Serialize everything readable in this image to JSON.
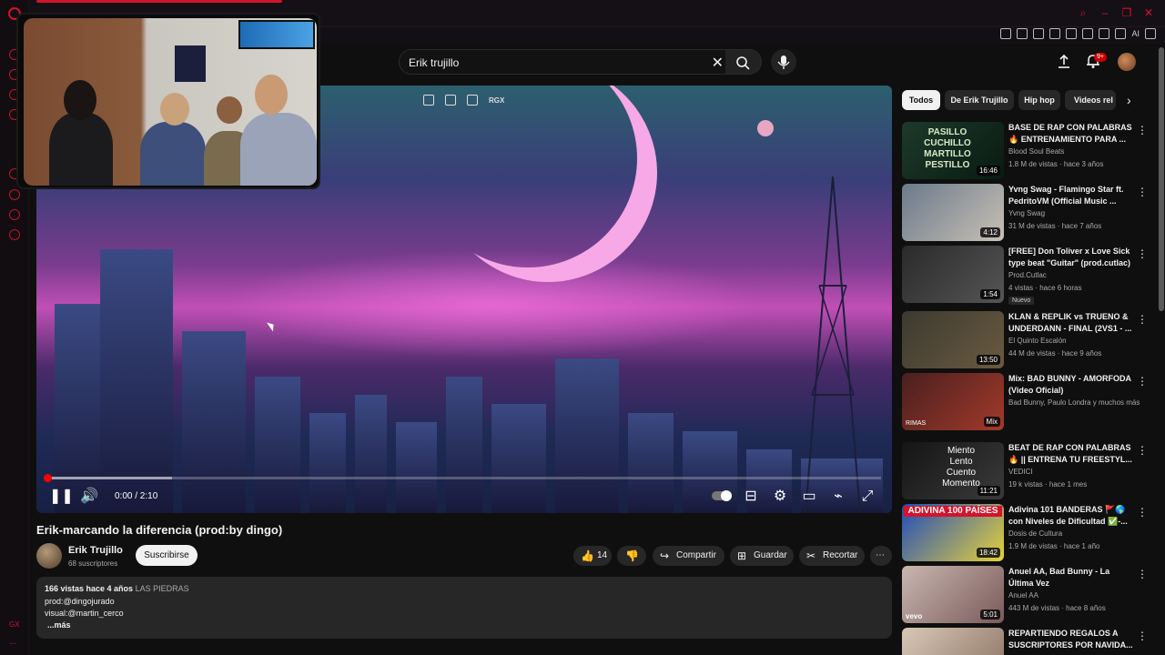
{
  "browser": {
    "accent": "#d3142c",
    "sidebar_label": "GX",
    "sidebar_more": "...",
    "toolbar_ai": "AI"
  },
  "header": {
    "search_value": "Erik trujillo",
    "notif_badge": "9+"
  },
  "player": {
    "overlay_text": "RGX",
    "time": "0:00 / 2:10",
    "progress_fraction": 0.0,
    "buffer_fraction": 0.15
  },
  "video": {
    "title": "Erik-marcando la diferencia (prod:by dingo)",
    "channel": "Erik Trujillo",
    "subscribers": "68 suscriptores",
    "subscribe_label": "Suscribirse",
    "likes": "14",
    "share_label": "Compartir",
    "save_label": "Guardar",
    "clip_label": "Recortar"
  },
  "description": {
    "stats": "166 vistas  hace 4 años",
    "location": "LAS PIEDRAS",
    "line1": "prod:@dingojurado",
    "line2": "visual:@martin_cerco",
    "more": "...más"
  },
  "chips": [
    "Todos",
    "De Erik Trujillo",
    "Hip hop",
    "Videos rel"
  ],
  "recommendations": [
    {
      "title": "BASE DE RAP CON PALABRAS 🔥 ENTRENAMIENTO PARA ...",
      "channel": "Blood Soul Beats",
      "meta": "1.8 M de vistas · hace 3 años",
      "duration": "16:46",
      "thumb_text": "PASILLO\nCUCHILLO\nMARTILLO\nPESTILLO"
    },
    {
      "title": "Yvng Swag - Flamingo Star ft. PedritoVM (Official Music ...",
      "channel": "Yvng Swag",
      "meta": "31 M de vistas · hace 7 años",
      "duration": "4:12",
      "thumb_text": ""
    },
    {
      "title": "[FREE] Don Toliver x Love Sick type beat \"Guitar\" (prod.cutlac)",
      "channel": "Prod.Cutlac",
      "meta": "4 vistas · hace 6 horas",
      "duration": "1:54",
      "badge": "Nuevo",
      "thumb_text": ""
    },
    {
      "title": "KLAN & REPLIK vs TRUENO & UNDERDANN - FINAL (2VS1 - ...",
      "channel": "El Quinto Escalón",
      "meta": "44 M de vistas · hace 9 años",
      "duration": "13:50",
      "thumb_text": ""
    },
    {
      "title": "Mix: BAD BUNNY - AMORFODA (Video Oficial)",
      "channel": "Bad Bunny, Paulo Londra y muchos más",
      "meta": "",
      "duration": "Mix",
      "thumb_text": "RIMAS"
    },
    {
      "title": "BEAT DE RAP CON PALABRAS 🔥 || ENTRENA TU FREESTYL...",
      "channel": "VEDICI",
      "meta": "19 k vistas · hace 1 mes",
      "duration": "11:21",
      "thumb_text": "Miento\nLento\nCuento\nMomento"
    },
    {
      "title": "Adivina 101 BANDERAS 🚩🌎 con Niveles de Dificultad ✅-...",
      "channel": "Dosis de Cultura",
      "meta": "1.9 M de vistas · hace 1 año",
      "duration": "18:42",
      "thumb_text": "ADIVINA 100 PAÍSES"
    },
    {
      "title": "Anuel AA, Bad Bunny - La Última Vez",
      "channel": "Anuel AA",
      "meta": "443 M de vistas · hace 8 años",
      "duration": "5:01",
      "thumb_text": "vevo"
    },
    {
      "title": "REPARTIENDO REGALOS A SUSCRIPTORES POR NAVIDA...",
      "channel": "",
      "meta": "",
      "duration": "",
      "thumb_text": ""
    }
  ]
}
